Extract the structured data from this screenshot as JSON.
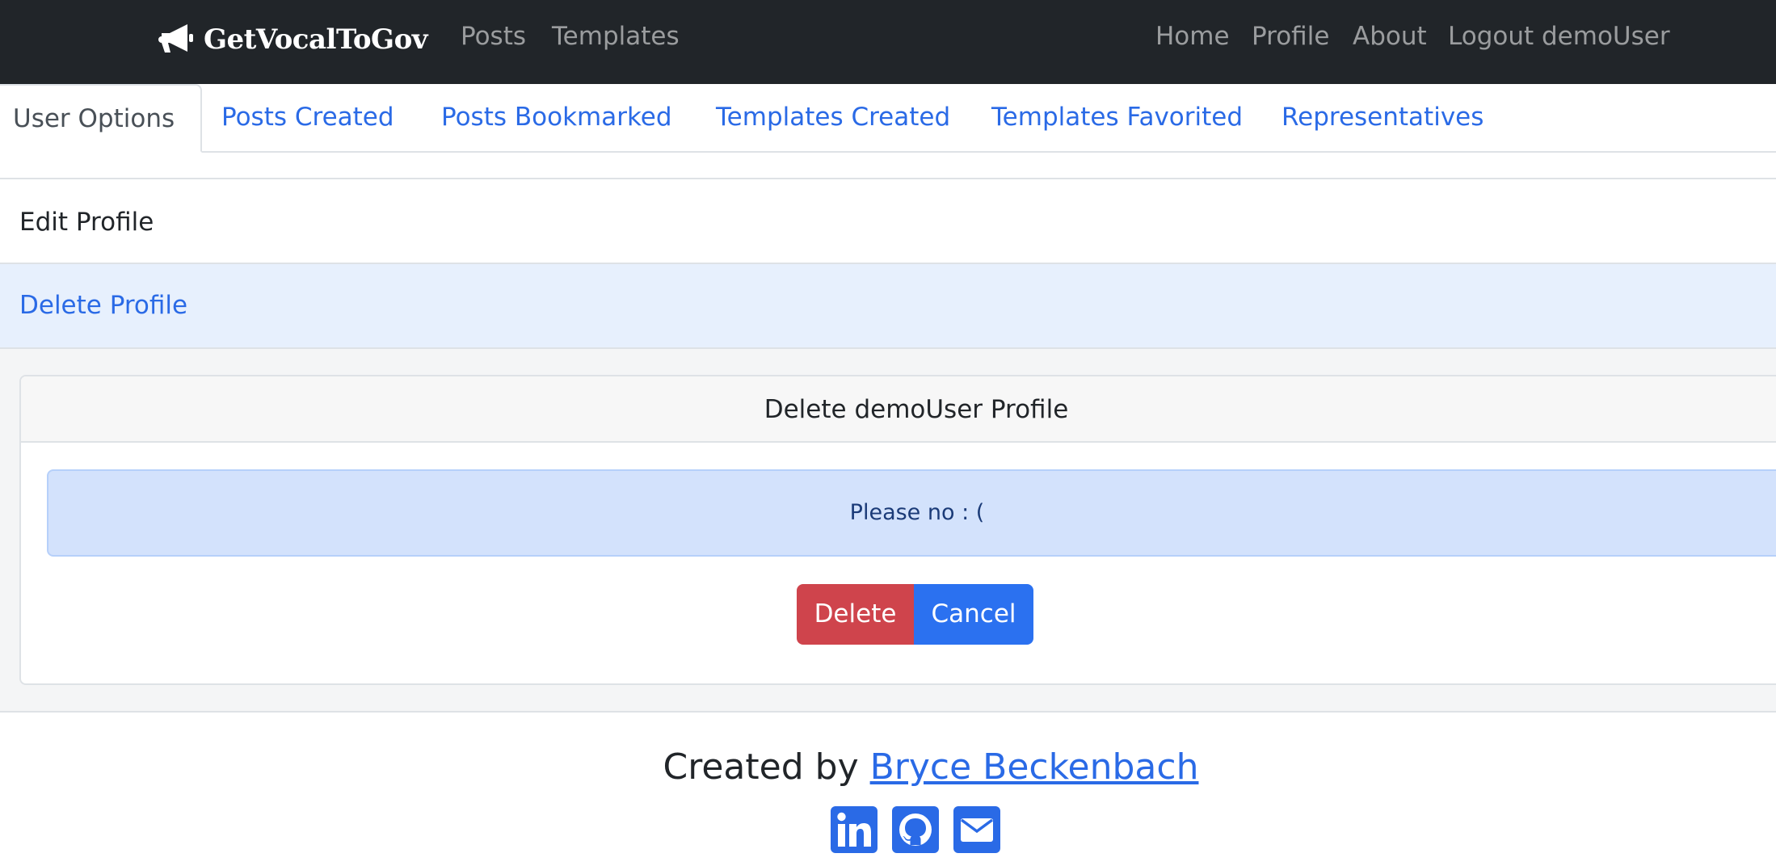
{
  "navbar": {
    "brand": "GetVocalToGov",
    "brand_icon": "megaphone-icon",
    "left_links": [
      "Posts",
      "Templates"
    ],
    "right_links": [
      "Home",
      "Profile",
      "About",
      "Logout demoUser"
    ]
  },
  "tabs": [
    "User Options",
    "Posts Created",
    "Posts Bookmarked",
    "Templates Created",
    "Templates Favorited",
    "Representatives"
  ],
  "options": {
    "edit_label": "Edit Profile",
    "delete_label": "Delete Profile"
  },
  "delete_card": {
    "title": "Delete demoUser Profile",
    "alert": "Please no : (",
    "delete_button": "Delete",
    "cancel_button": "Cancel"
  },
  "footer": {
    "created_by": "Created by",
    "author": "Bryce Beckenbach",
    "social": [
      "linkedin-icon",
      "github-icon",
      "email-icon"
    ]
  },
  "colors": {
    "navbar": "#212529",
    "link": "#2a6ae6",
    "danger": "#cf444c",
    "primary": "#2b71f0",
    "alert_bg": "#d3e2fc",
    "active_list_bg": "#e7f0fd"
  }
}
